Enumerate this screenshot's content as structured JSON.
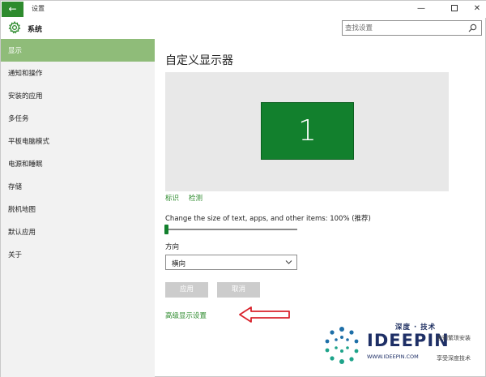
{
  "window": {
    "title": "设置",
    "back_glyph": "←",
    "min_glyph": "—",
    "close_glyph": "✕"
  },
  "header": {
    "title": "系统",
    "search_placeholder": "查找设置"
  },
  "sidebar": {
    "items": [
      {
        "label": "显示",
        "active": true
      },
      {
        "label": "通知和操作"
      },
      {
        "label": "安装的应用"
      },
      {
        "label": "多任务"
      },
      {
        "label": "平板电脑模式"
      },
      {
        "label": "电源和睡眠"
      },
      {
        "label": "存储"
      },
      {
        "label": "脱机地图"
      },
      {
        "label": "默认应用"
      },
      {
        "label": "关于"
      }
    ]
  },
  "main": {
    "title": "自定义显示器",
    "monitor_number": "1",
    "identify_label": "标识",
    "detect_label": "检测",
    "scale_label": "Change the size of text, apps, and other items: 100% (推荐)",
    "scale_value_percent": 100,
    "orientation_label": "方向",
    "orientation_value": "横向",
    "apply_label": "应用",
    "cancel_label": "取消",
    "advanced_label": "高级显示设置"
  },
  "watermark": {
    "chinese": "深度 · 技术",
    "brand": "IDEEPIN",
    "url": "WWW.IDEEPIN.COM",
    "tagline_1": "告别繁琐安装",
    "tagline_2": "享受深度技术"
  },
  "colors": {
    "accent": "#12802d",
    "sidebar_active": "#8fbc79",
    "link": "#2e8b2e",
    "arrow": "#d9232d",
    "brand_navy": "#1e2f66"
  },
  "icons": {
    "back": "arrow-left-icon",
    "settings": "gear-icon",
    "search": "search-icon",
    "dropdown": "chevron-down-icon",
    "annotation": "red-arrow-icon"
  }
}
